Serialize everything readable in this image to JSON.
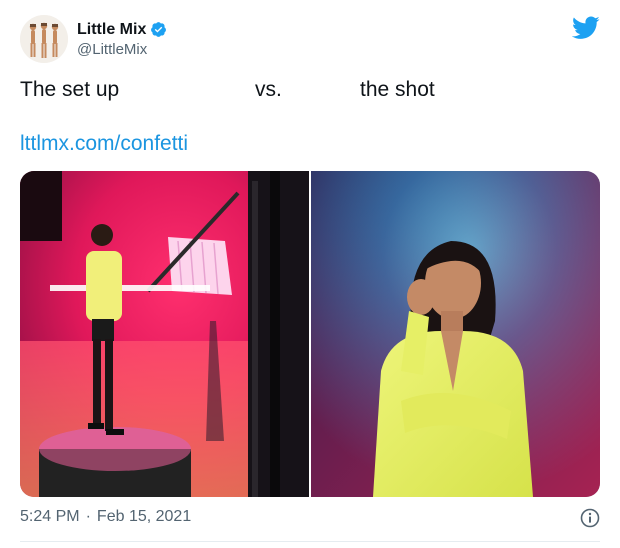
{
  "author": {
    "display_name": "Little Mix",
    "handle": "@LittleMix",
    "verified": true,
    "avatar_icon": "group-photo-avatar"
  },
  "tweet": {
    "text_parts": [
      "The set up",
      "vs.",
      "the shot"
    ],
    "link": "lttlmx.com/confetti"
  },
  "media": [
    {
      "name": "behind-the-scenes-photo",
      "icon": "photo-setup"
    },
    {
      "name": "final-shot-photo",
      "icon": "photo-portrait"
    }
  ],
  "meta": {
    "time": "5:24 PM",
    "separator": "·",
    "date": "Feb 15, 2021"
  },
  "colors": {
    "link": "#1b95e0",
    "twitter_blue": "#1da1f2",
    "secondary_text": "#536471"
  }
}
